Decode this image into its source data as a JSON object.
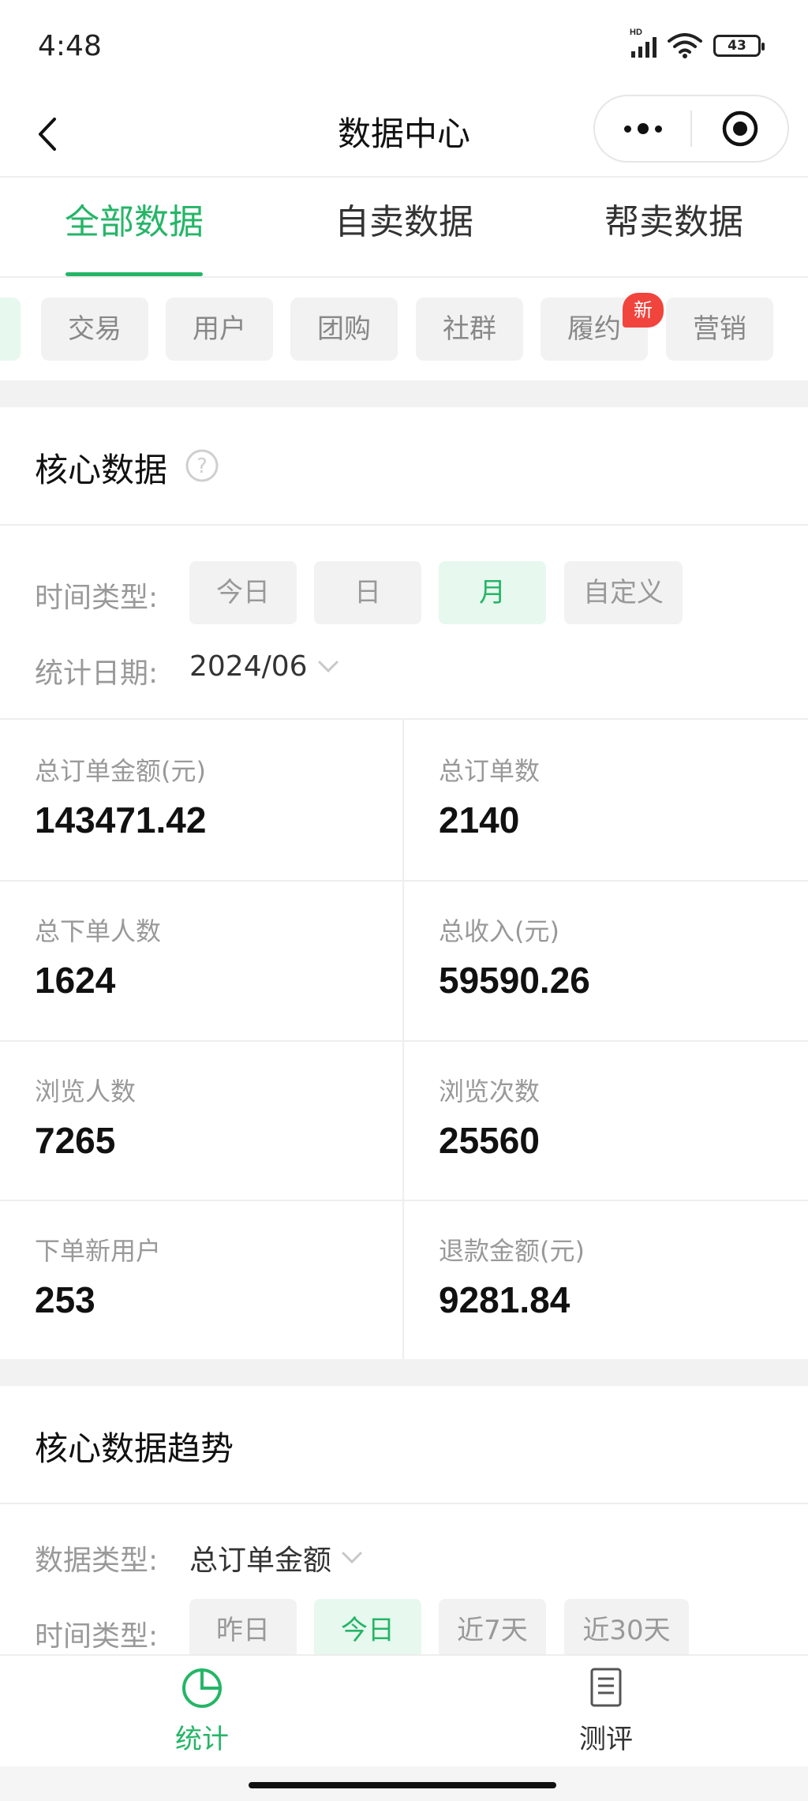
{
  "status_bar": {
    "time": "4:48",
    "network": "HD",
    "battery": "43"
  },
  "nav": {
    "title": "数据中心"
  },
  "main_tabs": [
    {
      "label": "全部数据",
      "active": true
    },
    {
      "label": "自卖数据",
      "active": false
    },
    {
      "label": "帮卖数据",
      "active": false
    }
  ],
  "chips": [
    {
      "label": "交易"
    },
    {
      "label": "用户"
    },
    {
      "label": "团购"
    },
    {
      "label": "社群"
    },
    {
      "label": "履约",
      "badge": "新"
    },
    {
      "label": "营销"
    }
  ],
  "core": {
    "title": "核心数据",
    "time_type_label": "时间类型:",
    "time_options": [
      "今日",
      "日",
      "月",
      "自定义"
    ],
    "time_selected": "月",
    "date_label": "统计日期:",
    "date_value": "2024/06",
    "stats": [
      {
        "label": "总订单金额(元)",
        "value": "143471.42"
      },
      {
        "label": "总订单数",
        "value": "2140"
      },
      {
        "label": "总下单人数",
        "value": "1624"
      },
      {
        "label": "总收入(元)",
        "value": "59590.26"
      },
      {
        "label": "浏览人数",
        "value": "7265"
      },
      {
        "label": "浏览次数",
        "value": "25560"
      },
      {
        "label": "下单新用户",
        "value": "253"
      },
      {
        "label": "退款金额(元)",
        "value": "9281.84"
      }
    ]
  },
  "trend": {
    "title": "核心数据趋势",
    "data_type_label": "数据类型:",
    "data_type_value": "总订单金额",
    "time_type_label": "时间类型:",
    "time_options": [
      "昨日",
      "今日",
      "近7天",
      "近30天"
    ],
    "time_selected": "今日"
  },
  "tabbar": [
    {
      "label": "统计",
      "icon": "pie-chart-icon",
      "active": true
    },
    {
      "label": "测评",
      "icon": "document-list-icon",
      "active": false
    }
  ],
  "colors": {
    "accent": "#25b567",
    "badge": "#f0443d",
    "muted": "#999999"
  }
}
